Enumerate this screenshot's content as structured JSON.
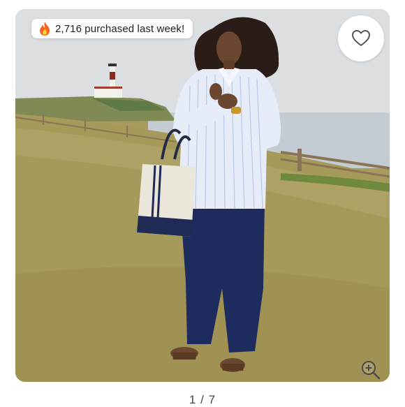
{
  "listing": {
    "purchase_badge": {
      "text": "2,716 purchased last week!",
      "icon": "fire-icon"
    },
    "like_button": {
      "icon": "heart-outline-icon"
    },
    "zoom_button": {
      "icon": "zoom-in-icon"
    },
    "pagination": {
      "current": "1",
      "separator": "/",
      "total": "7"
    }
  },
  "colors": {
    "badge_text": "#1f1f1f",
    "heart_stroke": "#555555",
    "pager_text": "#444444",
    "flame_outer": "#f26522",
    "flame_inner": "#ffcc33"
  }
}
